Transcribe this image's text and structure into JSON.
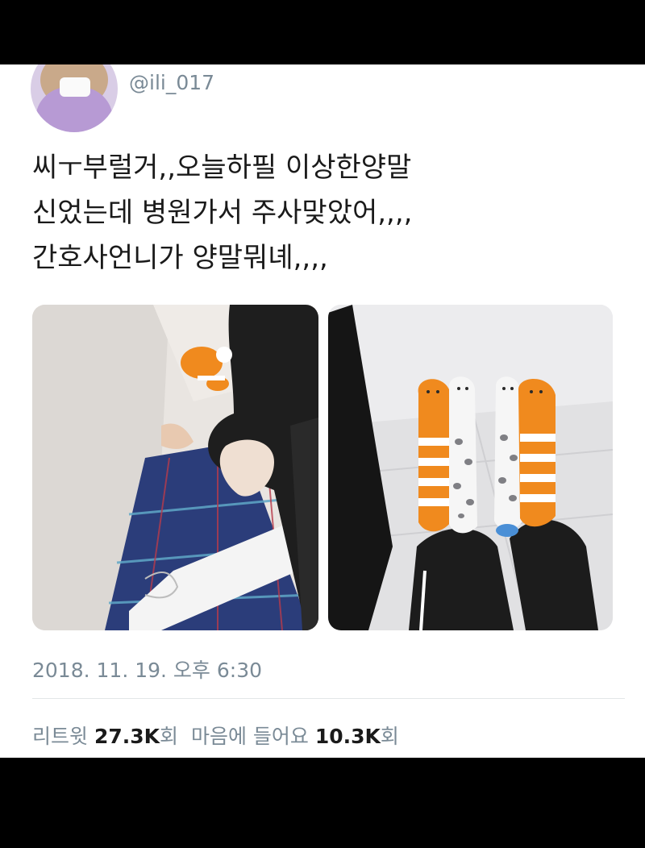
{
  "user": {
    "handle": "@ili_017"
  },
  "tweet": {
    "lines": [
      "씨ㅜ부럴거,,오늘하필 이상한양말",
      "신었는데 병원가서 주사맞았어,,,,",
      "간호사언니가 양말뭐녜,,,,"
    ]
  },
  "photos": [
    {
      "name": "sitting-legs-photo",
      "icon": "photo-image"
    },
    {
      "name": "feet-socks-photo",
      "icon": "photo-image"
    }
  ],
  "meta": {
    "timestamp": "2018. 11. 19. 오후 6:30"
  },
  "stats": {
    "retweet_label": "리트윗",
    "retweet_count": "27.3K",
    "retweet_unit": "회",
    "like_label": "마음에 들어요",
    "like_count": "10.3K",
    "like_unit": "회"
  },
  "colors": {
    "background": "#000000",
    "card": "#ffffff",
    "secondary_text": "#7a8a96",
    "sock_orange": "#f08a1e"
  }
}
